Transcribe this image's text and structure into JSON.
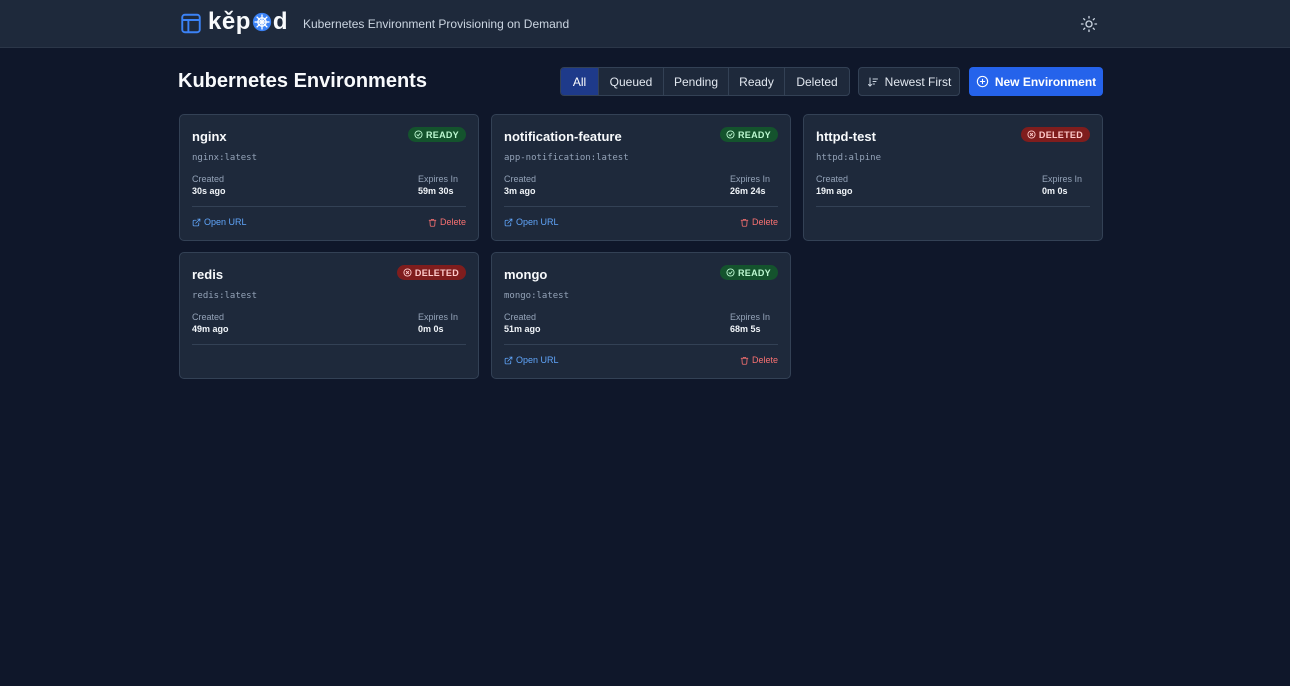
{
  "header": {
    "brand": "kěpod",
    "tagline": "Kubernetes Environment Provisioning on Demand"
  },
  "toolbar": {
    "title": "Kubernetes Environments",
    "filters": [
      {
        "label": "All",
        "active": true
      },
      {
        "label": "Queued",
        "active": false
      },
      {
        "label": "Pending",
        "active": false
      },
      {
        "label": "Ready",
        "active": false
      },
      {
        "label": "Deleted",
        "active": false
      }
    ],
    "sort_label": "Newest First",
    "new_label": "New Environment"
  },
  "labels": {
    "created": "Created",
    "expires": "Expires In",
    "open_url": "Open URL",
    "delete": "Delete"
  },
  "environments": [
    {
      "name": "nginx",
      "image": "nginx:latest",
      "status": "READY",
      "created": "30s ago",
      "expires": "59m 30s"
    },
    {
      "name": "notification-feature",
      "image": "app-notification:latest",
      "status": "READY",
      "created": "3m ago",
      "expires": "26m 24s"
    },
    {
      "name": "httpd-test",
      "image": "httpd:alpine",
      "status": "DELETED",
      "created": "19m ago",
      "expires": "0m 0s"
    },
    {
      "name": "redis",
      "image": "redis:latest",
      "status": "DELETED",
      "created": "49m ago",
      "expires": "0m 0s"
    },
    {
      "name": "mongo",
      "image": "mongo:latest",
      "status": "READY",
      "created": "51m ago",
      "expires": "68m 5s"
    }
  ],
  "colors": {
    "background": "#0f172a",
    "surface": "#1e293b",
    "accent": "#2563eb",
    "ready": "#14532d",
    "deleted": "#7f1d1d",
    "link": "#60a5fa",
    "danger": "#f87171"
  },
  "icons": {
    "logo": "layout-panel-icon",
    "theme": "sun-icon",
    "sort": "sort-descending-icon",
    "new": "plus-circle-icon",
    "ready": "check-circle-icon",
    "deleted": "x-circle-icon",
    "open": "external-link-icon",
    "delete": "trash-icon"
  }
}
